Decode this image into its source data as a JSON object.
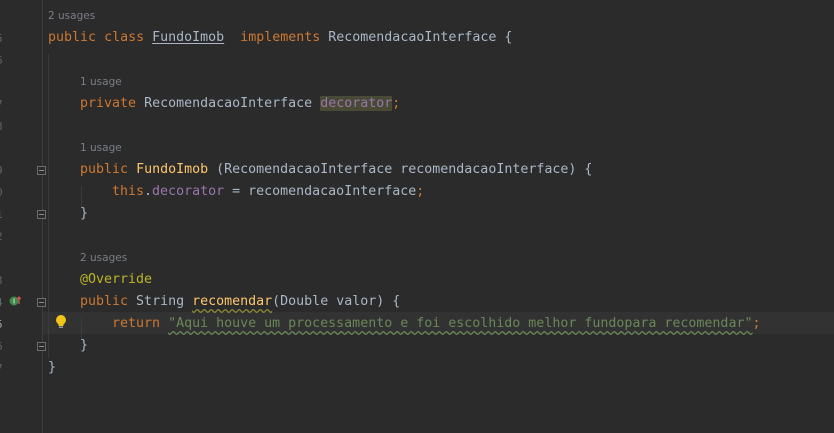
{
  "gutter": {
    "line_numbers": [
      "5",
      "6",
      "7",
      "8",
      "9",
      "0",
      "1",
      "2",
      "3",
      "4",
      "5",
      "6",
      "7"
    ]
  },
  "code": {
    "hint_class": "2 usages",
    "class_decl": {
      "public": "public",
      "class": "class",
      "name": "FundoImob",
      "implements": "implements",
      "interface": "RecomendacaoInterface",
      "brace": "{"
    },
    "hint_field": "1 usage",
    "field_decl": {
      "private": "private",
      "type": "RecomendacaoInterface",
      "name": "decorator",
      "semi": ";"
    },
    "hint_ctor": "1 usage",
    "ctor_decl": {
      "public": "public",
      "name": "FundoImob",
      "params": " (RecomendacaoInterface recomendacaoInterface) {"
    },
    "ctor_body": {
      "this": "this",
      "dot": ".",
      "field": "decorator",
      "rest": " = recomendacaoInterface",
      "semi": ";"
    },
    "ctor_close": "}",
    "hint_method": "2 usages",
    "annotation": "@Override",
    "method_decl": {
      "public": "public",
      "type": " String ",
      "name": "recomendar",
      "params": "(Double valor) {"
    },
    "method_body": {
      "return": "return",
      "string": "\"Aqui houve um processamento e foi escolhido melhor fundopara recomendar\"",
      "semi": ";"
    },
    "method_close": "}",
    "class_close": "}"
  }
}
